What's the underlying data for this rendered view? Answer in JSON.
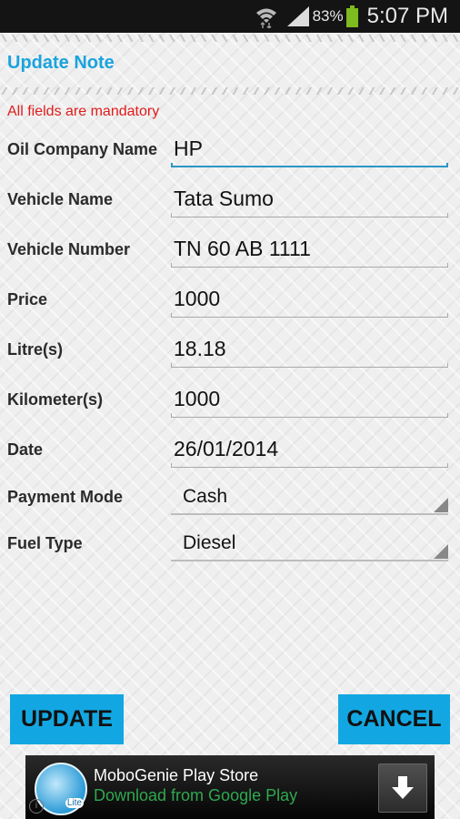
{
  "status_bar": {
    "battery_percent": "83%",
    "time": "5:07 PM",
    "battery_color": "#7dbb1e"
  },
  "header": {
    "title": "Update Note",
    "title_color": "#1aa3de"
  },
  "form": {
    "notice": "All fields are mandatory",
    "notice_color": "#e01b1b",
    "fields": [
      {
        "label": "Oil Company Name",
        "value": "HP",
        "type": "text",
        "focused": true
      },
      {
        "label": "Vehicle Name",
        "value": "Tata Sumo",
        "type": "text"
      },
      {
        "label": "Vehicle Number",
        "value": "TN 60 AB 1111",
        "type": "text"
      },
      {
        "label": "Price",
        "value": "1000",
        "type": "number"
      },
      {
        "label": "Litre(s)",
        "value": "18.18",
        "type": "number"
      },
      {
        "label": "Kilometer(s)",
        "value": "1000",
        "type": "number"
      },
      {
        "label": "Date",
        "value": "26/01/2014",
        "type": "date"
      },
      {
        "label": "Payment Mode",
        "value": "Cash",
        "type": "select"
      },
      {
        "label": "Fuel Type",
        "value": "Diesel",
        "type": "select"
      }
    ]
  },
  "actions": {
    "update_label": "UPDATE",
    "cancel_label": "CANCEL",
    "button_color": "#12a7e2"
  },
  "ad": {
    "title": "MoboGenie Play Store",
    "subtitle": "Download from Google Play",
    "logo_badge": "Lite",
    "subtitle_color": "#2fa84f"
  }
}
